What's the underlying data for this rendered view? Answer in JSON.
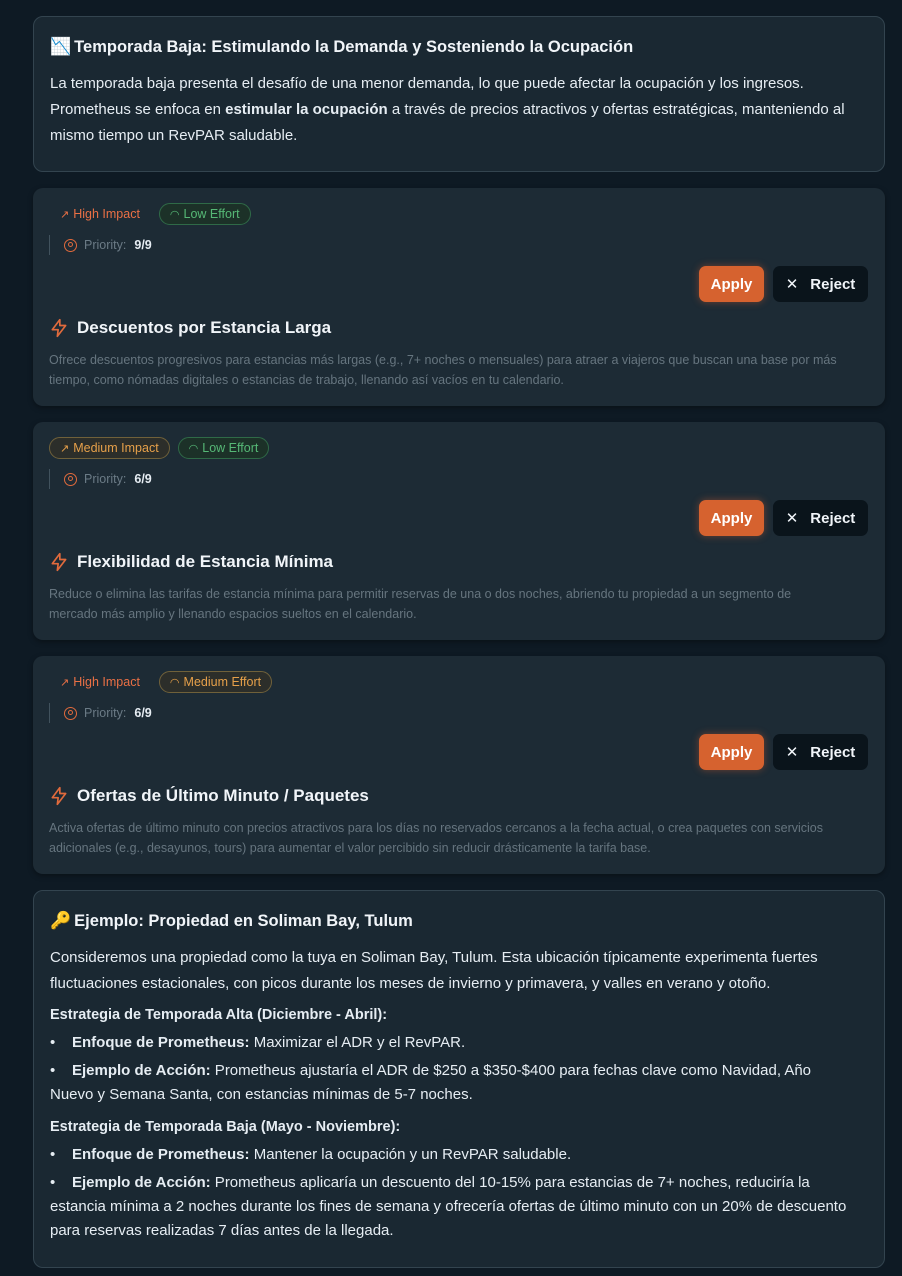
{
  "low_season": {
    "icon": "chart-decreasing-emoji",
    "emoji": "📉",
    "title": "Temporada Baja: Estimulando la Demanda y Sosteniendo la Ocupación",
    "para_1": "La temporada baja presenta el desafío de una menor demanda, lo que puede afectar la ocupación y los ingresos.",
    "para_2_pre": "Prometheus se enfoca en ",
    "para_2_bold": "estimular la ocupación",
    "para_2_post": " a través de precios atractivos y ofertas estratégicas, manteniendo al",
    "para_3": "mismo tiempo un RevPAR saludable."
  },
  "recommendations": [
    {
      "impact": "High Impact",
      "effort": "Low Effort",
      "priority_label": "Priority:",
      "priority_value": "9/9",
      "apply_label": "Apply",
      "reject_label": "Reject",
      "title": "Descuentos por Estancia Larga",
      "desc_1": "Ofrece descuentos progresivos para estancias más largas (e.g., 7+ noches o mensuales) para atraer a viajeros que buscan una base por más",
      "desc_2": "tiempo, como nómadas digitales o estancias de trabajo, llenando así vacíos en tu calendario."
    },
    {
      "impact": "Medium Impact",
      "effort": "Low Effort",
      "priority_label": "Priority:",
      "priority_value": "6/9",
      "apply_label": "Apply",
      "reject_label": "Reject",
      "title": "Flexibilidad de Estancia Mínima",
      "desc_1": "Reduce o elimina las tarifas de estancia mínima para permitir reservas de una o dos noches, abriendo tu propiedad a un segmento de",
      "desc_2": "mercado más amplio y llenando espacios sueltos en el calendario."
    },
    {
      "impact": "High Impact",
      "effort": "Medium Effort",
      "priority_label": "Priority:",
      "priority_value": "6/9",
      "apply_label": "Apply",
      "reject_label": "Reject",
      "title": "Ofertas de Último Minuto / Paquetes",
      "desc_1": "Activa ofertas de último minuto con precios atractivos para los días no reservados cercanos a la fecha actual, o crea paquetes con servicios",
      "desc_2": "adicionales (e.g., desayunos, tours) para aumentar el valor percibido sin reducir drásticamente la tarifa base."
    }
  ],
  "example": {
    "icon": "key-emoji",
    "emoji": "🔑",
    "title": "Ejemplo: Propiedad en Soliman Bay, Tulum",
    "intro_1": "Consideremos una propiedad como la tuya en Soliman Bay, Tulum. Esta ubicación típicamente experimenta fuertes",
    "intro_2": "fluctuaciones estacionales, con picos durante los meses de invierno y primavera, y valles en verano y otoño.",
    "high_heading": "Estrategia de Temporada Alta (Diciembre - Abril):",
    "high_focus_label": "Enfoque de Prometheus:",
    "high_focus_text": " Maximizar el ADR y el RevPAR.",
    "high_example_label": "Ejemplo de Acción:",
    "high_example_text": " Prometheus ajustaría el ADR de $250 a $350-$400 para fechas clave como Navidad, Año Nuevo y Semana Santa, con estancias mínimas de 5-7 noches.",
    "low_heading": "Estrategia de Temporada Baja (Mayo - Noviembre):",
    "low_focus_label": "Enfoque de Prometheus:",
    "low_focus_text": " Mantener la ocupación y un RevPAR saludable.",
    "low_example_label": "Ejemplo de Acción:",
    "low_example_text": " Prometheus aplicaría un descuento del 10-15% para estancias de 7+ noches, reduciría la estancia mínima a 2 noches durante los fines de semana y ofrecería ofertas de último minuto con un 20% de descuento para reservas realizadas 7 días antes de la llegada."
  },
  "colors": {
    "background": "#0e1a24",
    "card": "#1d2b35",
    "accent": "#d6622f",
    "high_impact": "#ea7045",
    "low_effort": "#56b876",
    "medium": "#e6a04a"
  }
}
